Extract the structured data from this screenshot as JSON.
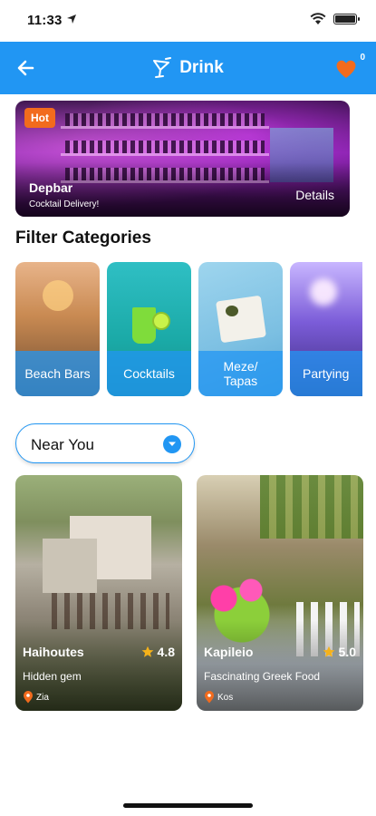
{
  "status_bar": {
    "time": "11:33"
  },
  "app_bar": {
    "title": "Drink",
    "favorites_count": "0"
  },
  "hero": {
    "badge": "Hot",
    "name": "Depbar",
    "subtitle": "Cocktail Delivery!",
    "details_label": "Details"
  },
  "filter_section": {
    "title": "Filter Categories",
    "categories": [
      {
        "label": "Beach Bars"
      },
      {
        "label": "Cocktails"
      },
      {
        "label": "Meze/\nTapas"
      },
      {
        "label": "Partying"
      }
    ]
  },
  "location_filter": {
    "selected": "Near You"
  },
  "places": [
    {
      "name": "Haihoutes",
      "rating": "4.8",
      "description": "Hidden gem",
      "location": "Zia"
    },
    {
      "name": "Kapileio",
      "rating": "5.0",
      "description": "Fascinating Greek Food",
      "location": "Kos"
    }
  ],
  "colors": {
    "primary": "#2196f3",
    "badge": "#f26b1d",
    "heart": "#f26b1d",
    "star": "#f6b21a",
    "pin": "#f26b1d"
  }
}
